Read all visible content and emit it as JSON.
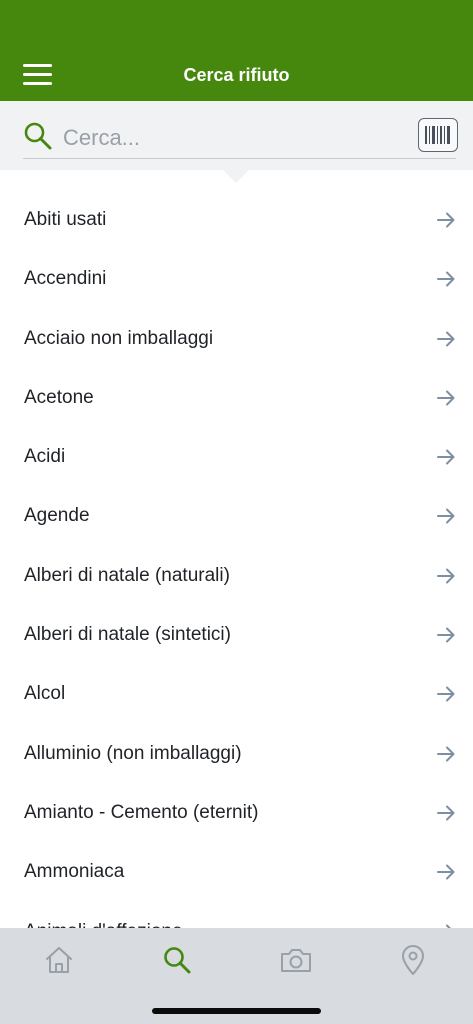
{
  "header": {
    "title": "Cerca rifiuto",
    "color": "#46880e"
  },
  "search": {
    "placeholder": "Cerca...",
    "value": ""
  },
  "items": [
    "Abiti usati",
    "Accendini",
    "Acciaio non imballaggi",
    "Acetone",
    "Acidi",
    "Agende",
    "Alberi di natale (naturali)",
    "Alberi di natale (sintetici)",
    "Alcol",
    "Alluminio (non imballaggi)",
    "Amianto - Cemento (eternit)",
    "Ammoniaca",
    "Animali d'affezione"
  ],
  "tabbar": {
    "tabs": [
      {
        "name": "home",
        "icon": "home-icon",
        "active": false
      },
      {
        "name": "search",
        "icon": "search-icon",
        "active": true
      },
      {
        "name": "camera",
        "icon": "camera-icon",
        "active": false
      },
      {
        "name": "map",
        "icon": "location-pin-icon",
        "active": false
      }
    ],
    "active_color": "#46880e",
    "inactive_color": "#9aa0a8"
  }
}
